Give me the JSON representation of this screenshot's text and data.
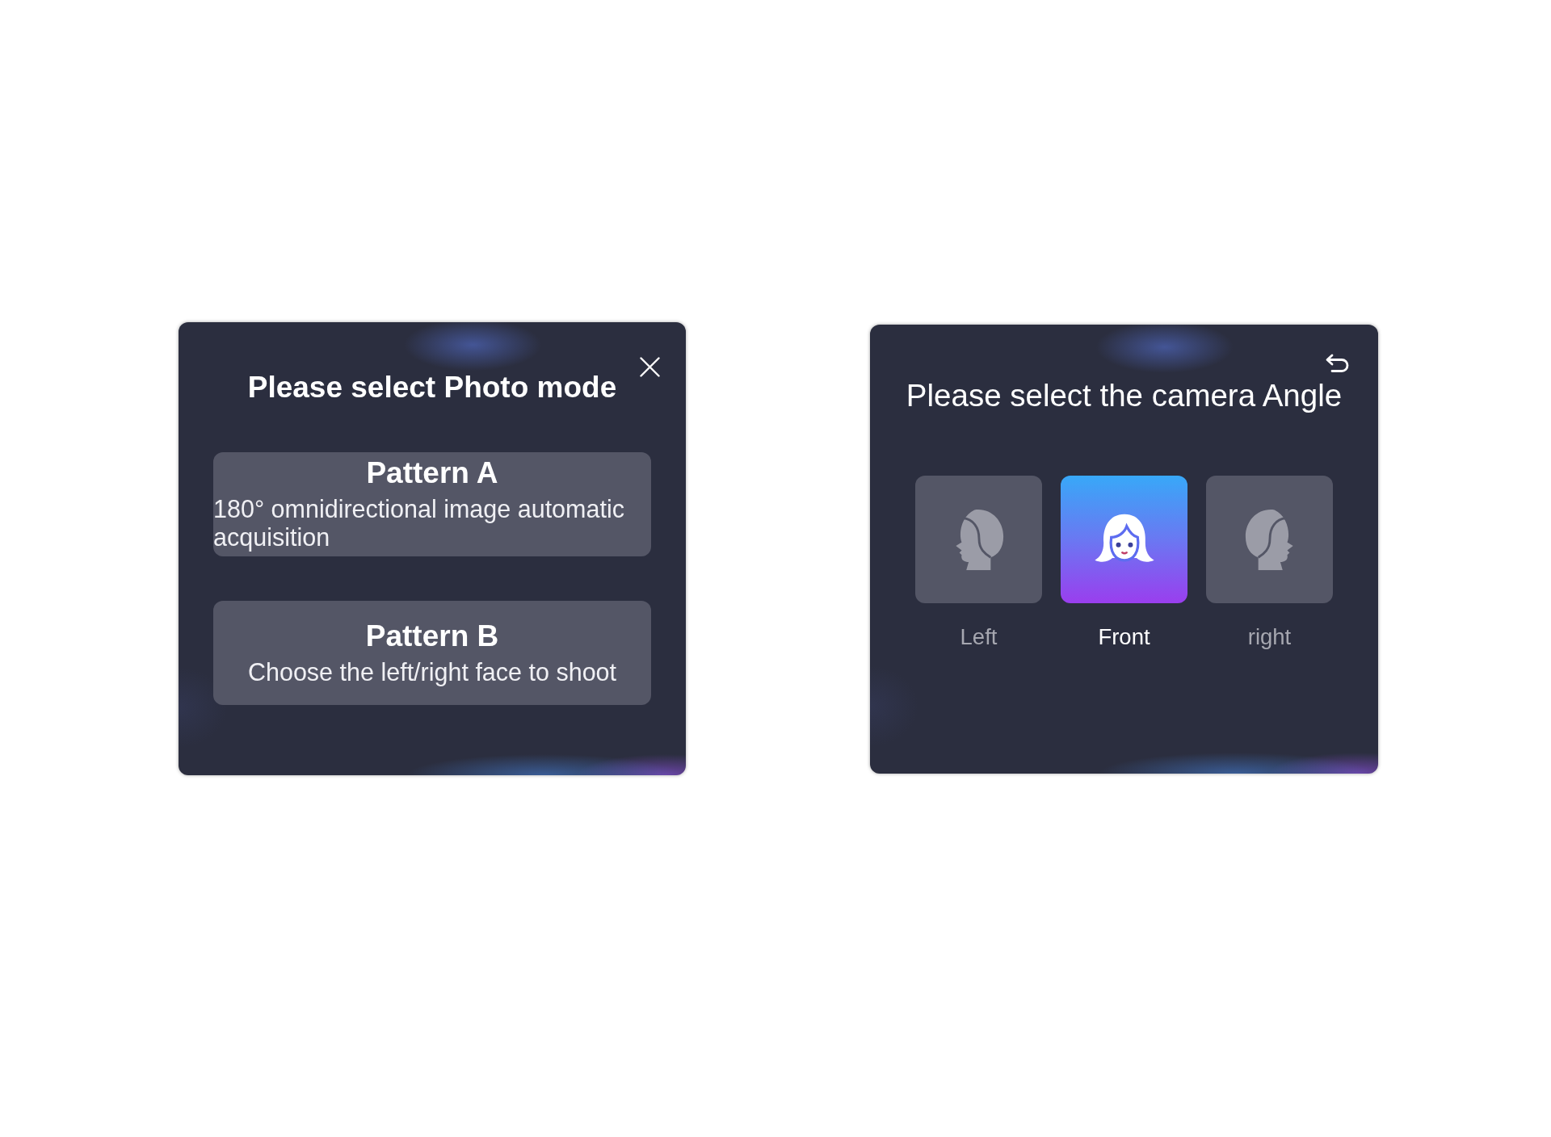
{
  "photo_mode_dialog": {
    "title": "Please select Photo mode",
    "options": [
      {
        "title": "Pattern A",
        "description": "180° omnidirectional image automatic acquisition"
      },
      {
        "title": "Pattern B",
        "description": "Choose the left/right face to shoot"
      }
    ]
  },
  "camera_angle_dialog": {
    "title": "Please select the camera Angle",
    "angles": [
      {
        "label": "Left",
        "kind": "left",
        "selected": false
      },
      {
        "label": "Front",
        "kind": "front",
        "selected": true
      },
      {
        "label": "right",
        "kind": "right",
        "selected": false
      }
    ]
  }
}
